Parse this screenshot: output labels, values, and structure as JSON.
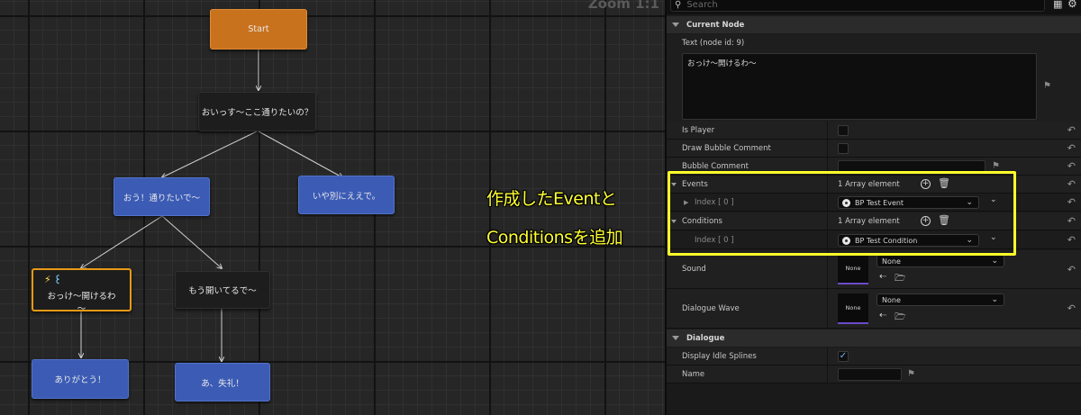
{
  "graph": {
    "zoom_label": "Zoom 1:1",
    "nodes": {
      "start": "Start",
      "npc_greeting": "おいっす～ここ通りたいの？",
      "player_yes": "おう！通りたいで～",
      "player_no": "いや別にええで。",
      "npc_ok": "おっけ～開けるわ～",
      "npc_opened": "もう開いてるで～",
      "player_thanks": "ありがとう！",
      "player_sorry": "あ、失礼！"
    }
  },
  "panel": {
    "search_placeholder": "Search",
    "current_node": {
      "header": "Current Node",
      "text_label": "Text (node id: 9)",
      "text_value": "おっけ～開けるわ～",
      "is_player_label": "Is Player",
      "is_player": false,
      "draw_bubble_label": "Draw Bubble Comment",
      "draw_bubble": false,
      "bubble_comment_label": "Bubble Comment",
      "events_label": "Events",
      "events_count": "1 Array element",
      "events_index": "Index [ 0 ]",
      "events_value": "BP Test Event",
      "conditions_label": "Conditions",
      "conditions_count": "1 Array element",
      "conditions_index": "Index [ 0 ]",
      "conditions_value": "BP Test Condition",
      "sound_label": "Sound",
      "sound_thumb": "None",
      "sound_value": "None",
      "wave_label": "Dialogue Wave",
      "wave_thumb": "None",
      "wave_value": "None"
    },
    "dialogue": {
      "header": "Dialogue",
      "display_idle_label": "Display Idle Splines",
      "display_idle": true,
      "name_label": "Name"
    }
  },
  "annotation": {
    "line1": "作成したEventと",
    "line2": "Conditionsを追加",
    "color": "#ffff2a"
  },
  "colors": {
    "start_node": "#c9721e",
    "player_node": "#3b5bb5",
    "npc_node": "#1d1d1d",
    "selected_border": "#e89a16"
  }
}
